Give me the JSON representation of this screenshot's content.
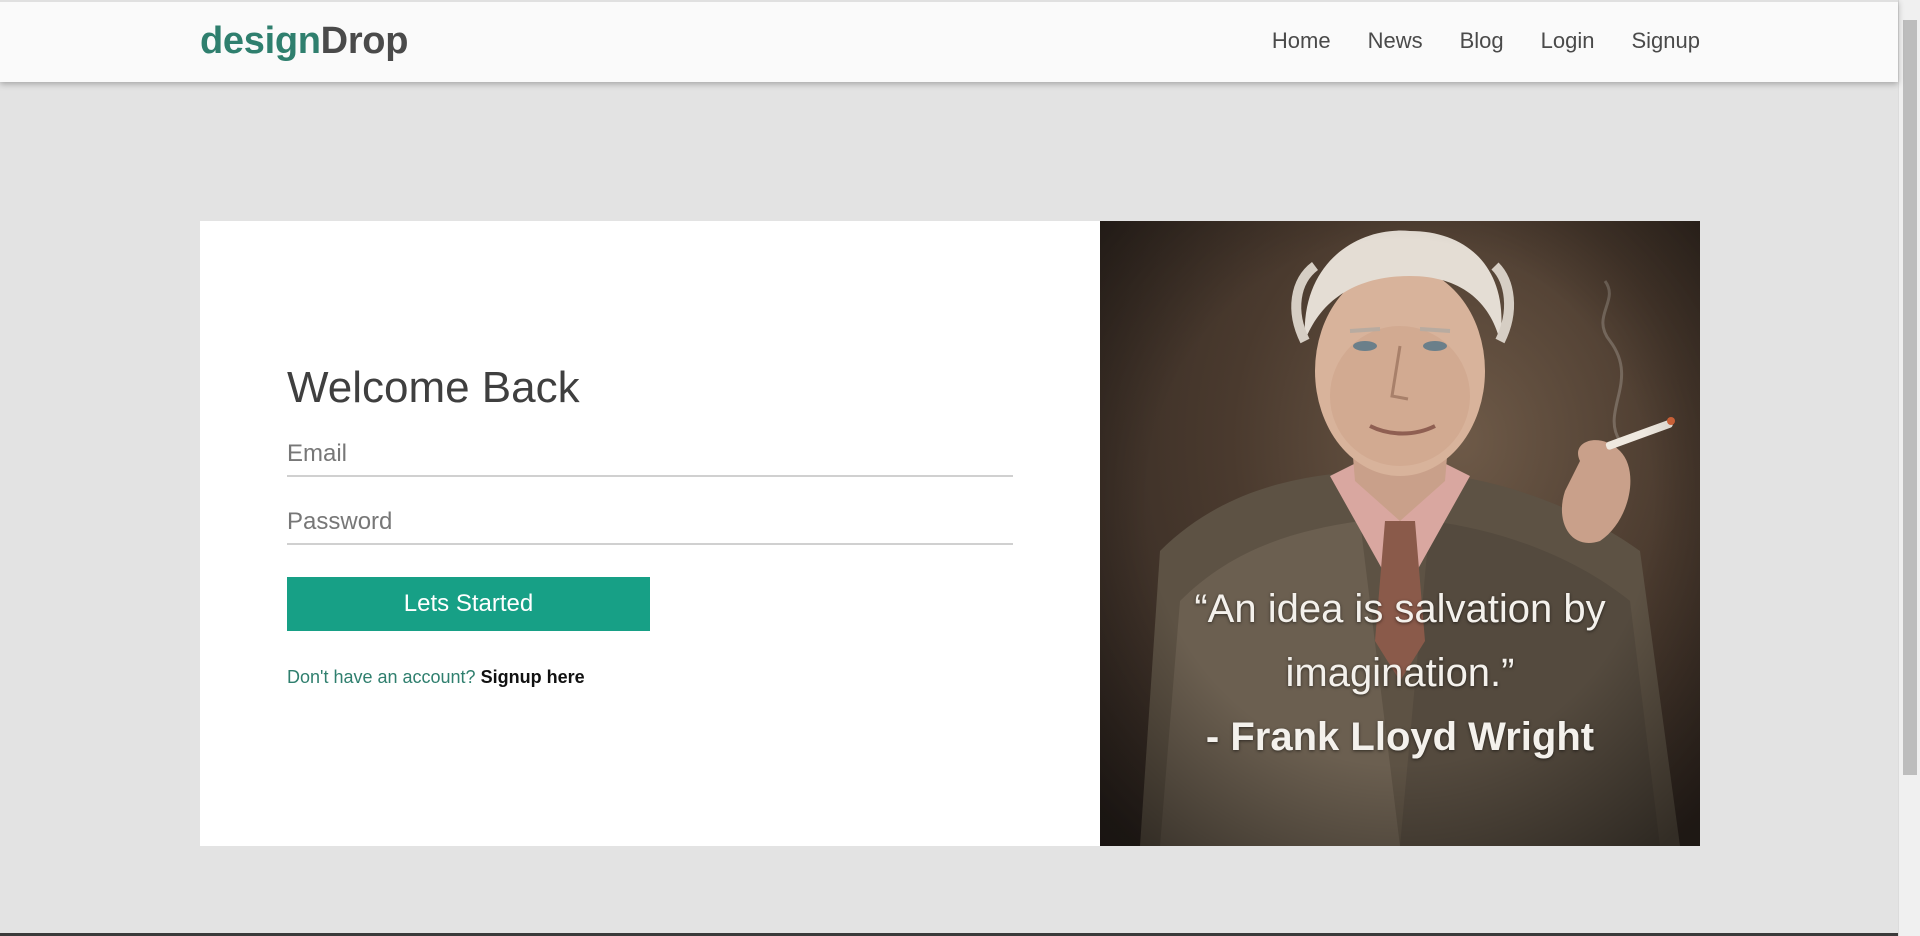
{
  "header": {
    "logo_part1": "design",
    "logo_part2": "Drop",
    "nav": [
      "Home",
      "News",
      "Blog",
      "Login",
      "Signup"
    ]
  },
  "login": {
    "title": "Welcome Back",
    "email_placeholder": "Email",
    "password_placeholder": "Password",
    "button_label": "Lets Started",
    "signup_prompt": "Don't have an account?",
    "signup_link": "Signup here"
  },
  "quote": {
    "line1": "“An idea is salvation by",
    "line2": "imagination.”",
    "author": "- Frank Lloyd Wright"
  },
  "colors": {
    "accent": "#17a086",
    "logo_green": "#2f7f6e",
    "background": "#e3e3e3"
  }
}
